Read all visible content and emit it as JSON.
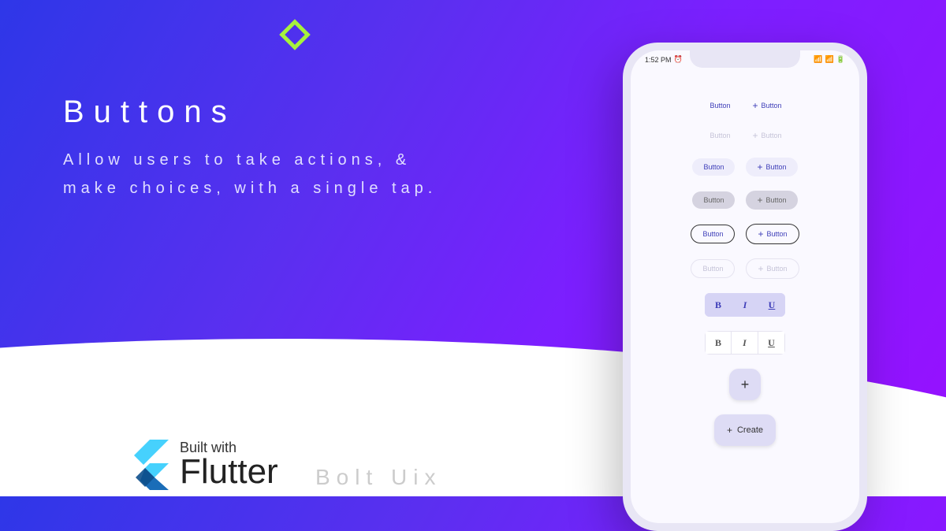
{
  "hero": {
    "title": "Buttons",
    "subtitle_line1": "Allow users to take actions, &",
    "subtitle_line2": "make choices, with a single tap."
  },
  "badge": {
    "built_with": "Built with",
    "name": "Flutter",
    "brand": "Bolt Uix"
  },
  "phone": {
    "status": {
      "time": "1:52 PM",
      "alarm": "⏰",
      "signal": "▲",
      "dots": "···",
      "wifi": "�長",
      "battery": "🔋",
      "bolt": "⚡"
    },
    "btn_label": "Button",
    "create_label": "Create",
    "format": {
      "bold": "B",
      "italic": "I",
      "underline": "U"
    }
  }
}
